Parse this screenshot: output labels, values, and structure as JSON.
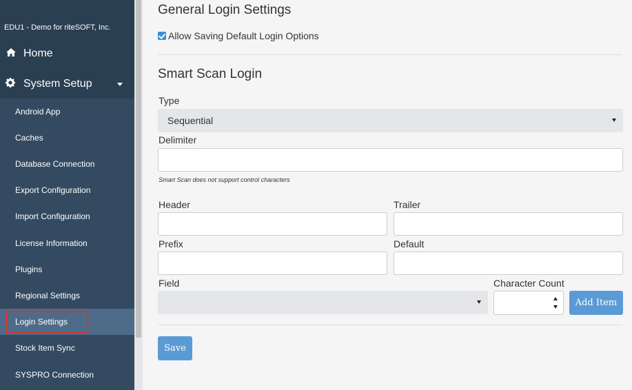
{
  "sidebar": {
    "org": "EDU1 - Demo for riteSOFT, Inc.",
    "home_label": "Home",
    "setup_label": "System Setup",
    "items": [
      {
        "label": "Android App"
      },
      {
        "label": "Caches"
      },
      {
        "label": "Database Connection"
      },
      {
        "label": "Export Configuration"
      },
      {
        "label": "Import Configuration"
      },
      {
        "label": "License Information"
      },
      {
        "label": "Plugins"
      },
      {
        "label": "Regional Settings"
      },
      {
        "label": "Login Settings",
        "active": true
      },
      {
        "label": "Stock Item Sync"
      },
      {
        "label": "SYSPRO Connection"
      }
    ],
    "icons": {
      "home": "home-icon",
      "setup": "gear-icon",
      "caret": "caret-down-icon"
    }
  },
  "general": {
    "title": "General Login Settings",
    "allow_saving_label": "Allow Saving Default Login Options",
    "allow_saving_checked": true
  },
  "smart_scan": {
    "title": "Smart Scan Login",
    "type_label": "Type",
    "type_value": "Sequential",
    "delimiter_label": "Delimiter",
    "delimiter_value": "",
    "hint": "Smart Scan does not support control characters",
    "header_label": "Header",
    "header_value": "",
    "trailer_label": "Trailer",
    "trailer_value": "",
    "prefix_label": "Prefix",
    "prefix_value": "",
    "default_label": "Default",
    "default_value": "",
    "field_label": "Field",
    "field_value": "",
    "char_count_label": "Character Count",
    "char_count_value": "",
    "add_item_label": "Add Item"
  },
  "actions": {
    "save_label": "Save"
  },
  "colors": {
    "sidebar": "#334a61",
    "active": "#4e6c8a",
    "highlight": "#d9322a",
    "button": "#5b9bd5"
  }
}
